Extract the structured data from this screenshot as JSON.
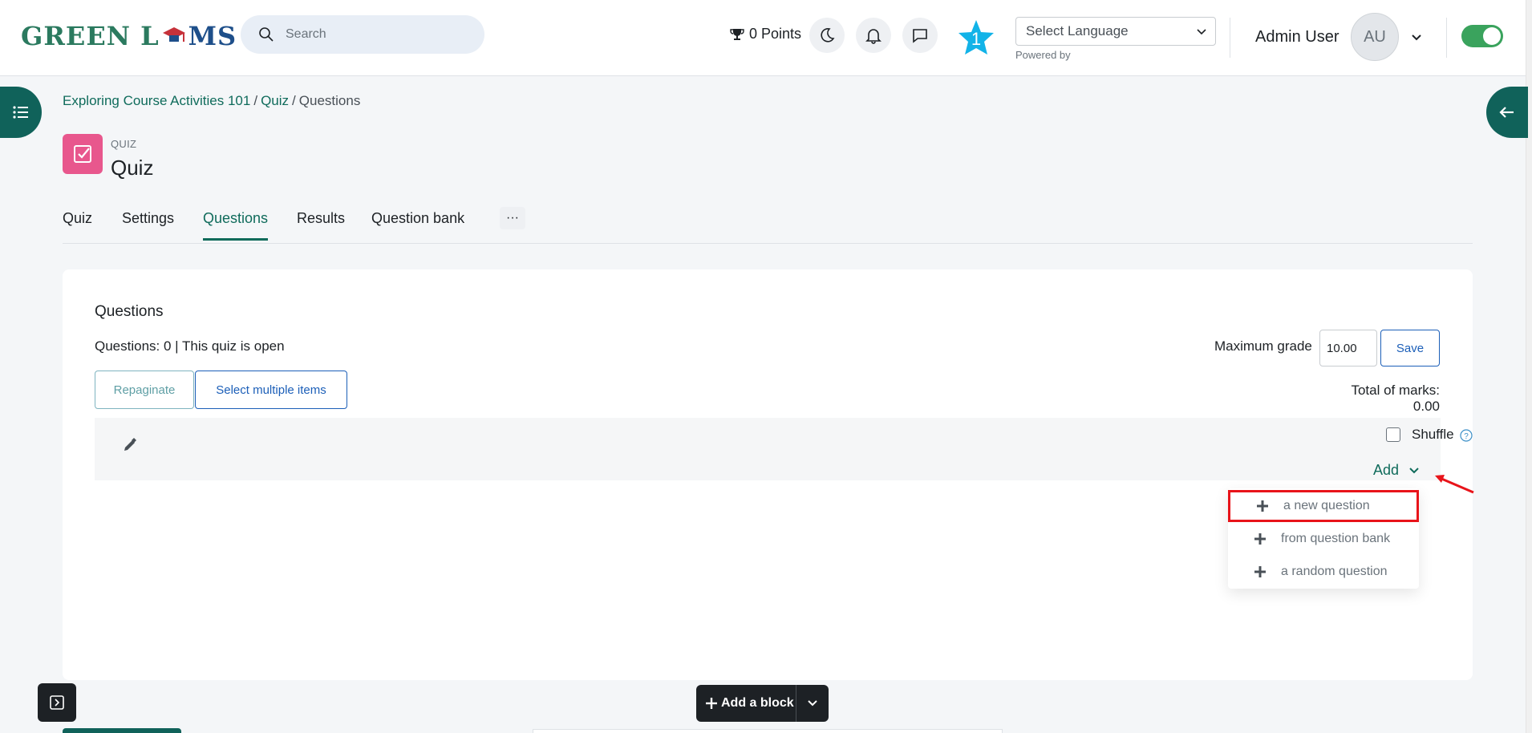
{
  "header": {
    "logo_text_left": "GREEN L",
    "logo_text_right": "MS",
    "search_placeholder": "Search",
    "points": "0 Points",
    "notification_count": "1",
    "language_select": "Select Language",
    "powered_by": "Powered by",
    "user_name": "Admin User",
    "avatar_initials": "AU"
  },
  "breadcrumb": {
    "course": "Exploring Course Activities 101",
    "activity": "Quiz",
    "current": "Questions",
    "separator": "/"
  },
  "activity": {
    "type_label": "QUIZ",
    "title": "Quiz",
    "icon_color": "#e8578d"
  },
  "tabs": [
    {
      "label": "Quiz"
    },
    {
      "label": "Settings"
    },
    {
      "label": "Questions",
      "active": true
    },
    {
      "label": "Results"
    },
    {
      "label": "Question bank"
    }
  ],
  "tabs_more": "···",
  "questions_panel": {
    "heading": "Questions",
    "info": "Questions: 0 | This quiz is open",
    "repaginate_label": "Repaginate",
    "select_multiple_label": "Select multiple items",
    "max_grade_label": "Maximum grade",
    "max_grade_value": "10.00",
    "save_label": "Save",
    "total_marks": "Total of marks: 0.00",
    "shuffle_label": "Shuffle",
    "add_label": "Add"
  },
  "add_menu": {
    "items": [
      {
        "label": "a new question",
        "highlighted": true
      },
      {
        "label": "from question bank"
      },
      {
        "label": "a random question"
      }
    ]
  },
  "footer": {
    "add_block_label": "Add a block"
  },
  "colors": {
    "primary": "#0f6b5b",
    "drawer": "#10625a",
    "highlight": "#e8141a",
    "toggle_on": "#3aa35d",
    "star_badge": "#12b3e8"
  }
}
